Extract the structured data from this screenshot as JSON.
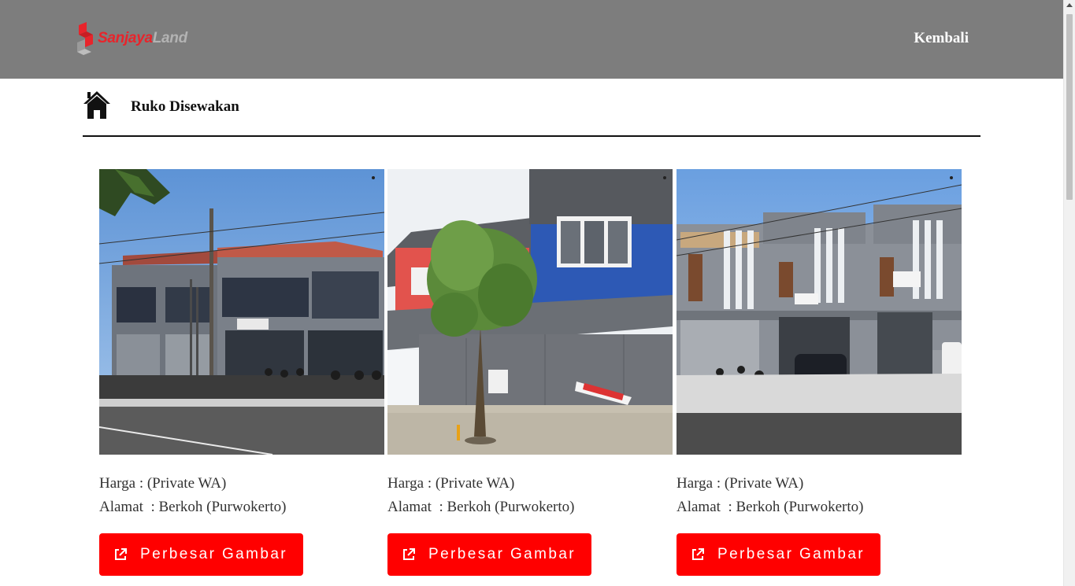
{
  "header": {
    "logo_text_primary": "Sanjaya",
    "logo_text_secondary": "Land",
    "back_link": "Kembali",
    "background_color": "#7d7d7d"
  },
  "page": {
    "icon": "home-icon",
    "title": "Ruko Disewakan"
  },
  "listings": [
    {
      "price_label": "Harga",
      "price_value": "(Private WA)",
      "address_label": "Alamat",
      "address_value": "Berkoh (Purwokerto)",
      "button_label": "Perbesar Gambar",
      "button_icon": "external-link-icon"
    },
    {
      "price_label": "Harga",
      "price_value": "(Private WA)",
      "address_label": "Alamat",
      "address_value": "Berkoh (Purwokerto)",
      "button_label": "Perbesar Gambar",
      "button_icon": "external-link-icon"
    },
    {
      "price_label": "Harga",
      "price_value": "(Private WA)",
      "address_label": "Alamat",
      "address_value": "Berkoh (Purwokerto)",
      "button_label": "Perbesar Gambar",
      "button_icon": "external-link-icon"
    }
  ],
  "colors": {
    "accent": "#ff0000",
    "logo_red": "#e8242b",
    "logo_gray": "#b3b3b3"
  }
}
